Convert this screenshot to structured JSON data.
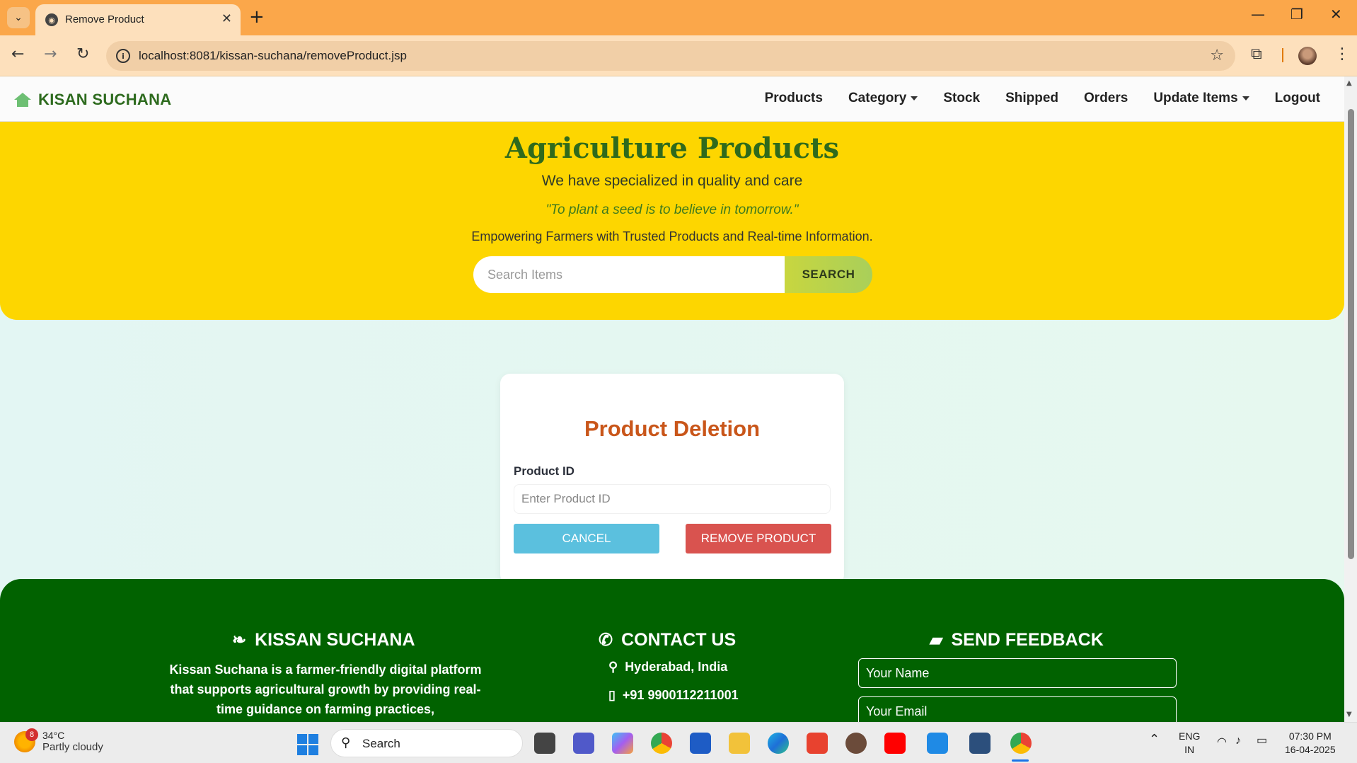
{
  "browser": {
    "tab_title": "Remove Product",
    "url": "localhost:8081/kissan-suchana/removeProduct.jsp"
  },
  "nav": {
    "brand": "KISAN SUCHANA",
    "items": [
      "Products",
      "Category",
      "Stock",
      "Shipped",
      "Orders",
      "Update Items",
      "Logout"
    ]
  },
  "hero": {
    "title": "Agriculture Products",
    "subtitle": "We have specialized in quality and care",
    "quote": "\"To plant a seed is to believe in tomorrow.\"",
    "tagline": "Empowering Farmers with Trusted Products and Real-time Information.",
    "search_placeholder": "Search Items",
    "search_button": "SEARCH"
  },
  "form": {
    "title": "Product Deletion",
    "label": "Product ID",
    "placeholder": "Enter Product ID",
    "cancel": "CANCEL",
    "remove": "REMOVE PRODUCT"
  },
  "footer": {
    "about_title": "KISSAN SUCHANA",
    "about_text": "Kissan Suchana is a farmer-friendly digital platform that supports agricultural growth by providing real-time guidance on farming practices,",
    "contact_title": "CONTACT US",
    "location": "Hyderabad, India",
    "phone": "+91 9900112211001",
    "feedback_title": "SEND FEEDBACK",
    "name_placeholder": "Your Name",
    "email_placeholder": "Your Email"
  },
  "taskbar": {
    "weather_temp": "34°C",
    "weather_desc": "Partly cloudy",
    "weather_badge": "8",
    "search": "Search",
    "lang1": "ENG",
    "lang2": "IN",
    "time": "07:30 PM",
    "date": "16-04-2025"
  },
  "colors": {
    "hero_bg": "#fdd600",
    "footer_bg": "#016200",
    "cancel_btn": "#5bc0de",
    "remove_btn": "#d9534f",
    "title_accent": "#c9561a"
  }
}
